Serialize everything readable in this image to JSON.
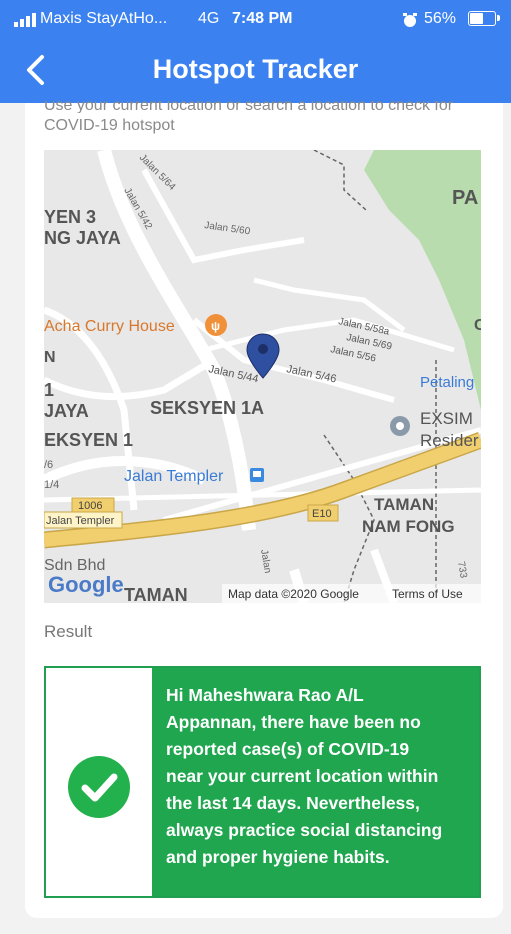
{
  "status_bar": {
    "carrier": "Maxis StayAtHo...",
    "network": "4G",
    "time": "7:48 PM",
    "battery": "56%",
    "battery_level": 0.56
  },
  "header": {
    "title": "Hotspot Tracker",
    "back_icon": "chevron-left-icon"
  },
  "hint_text": "Use your current location or search a location to check for COVID-19 hotspot",
  "hint_line1": "Use your current location or search a location to check for",
  "hint_line2": "COVID-19 hotspot",
  "map": {
    "labels": {
      "pa": "PA",
      "yen3": "YEN 3",
      "ngjaya": "NG JAYA",
      "jalan564": "Jalan 5/64",
      "jalan542": "Jalan 5/42",
      "jalan560": "Jalan 5/60",
      "acha": "Acha Curry House",
      "n": "N",
      "c": "C",
      "jalan558a": "Jalan 5/58a",
      "jalan569": "Jalan 5/69",
      "jalan556": "Jalan 5/56",
      "jalan544": "Jalan 5/44",
      "jalan546": "Jalan 5/46",
      "petaling": "Petaling",
      "one": "1",
      "jaya": "JAYA",
      "seksyen1a": "SEKSYEN 1A",
      "eksyen1": "EKSYEN 1",
      "exsim": "EXSIM",
      "resider": "Resider",
      "six": "/6",
      "onequarter": "1/4",
      "jtempler": "Jalan Templer",
      "r1006": "1006",
      "jtempler2": "Jalan Templer",
      "taman": "TAMAN",
      "namfong": "NAM FONG",
      "e10": "E10",
      "sdnbhd": "Sdn Bhd",
      "taman2": "TAMAN",
      "jalan_v": "Jalan",
      "r733": "733",
      "google": "Google",
      "mapdata": "Map data ©2020 Google",
      "terms": "Terms of Use"
    },
    "colors": {
      "bg": "#e8e8e8",
      "green": "#b8dcae",
      "road": "#ffffff",
      "highway": "#f2cf6e"
    }
  },
  "result": {
    "label": "Result",
    "status_icon": "check-circle-icon",
    "color": "#1fa64e",
    "lines": [
      "Hi Maheshwara Rao A/L",
      "Appannan, there have been no",
      "reported case(s) of COVID-19",
      "near your current location within",
      "the last 14 days. Nevertheless,",
      "always practice social distancing",
      "and proper hygiene habits."
    ]
  }
}
